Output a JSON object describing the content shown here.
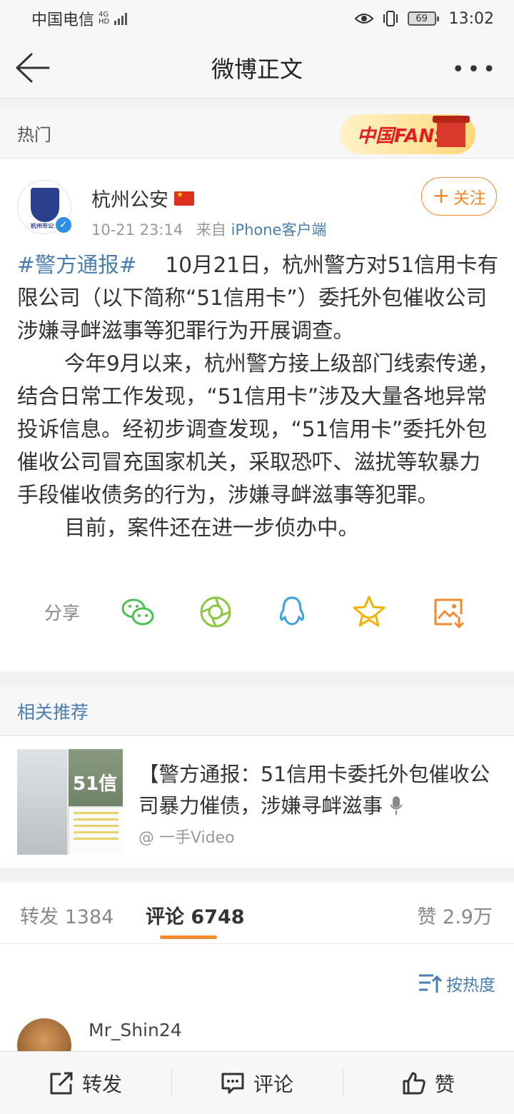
{
  "status": {
    "carrier": "中国电信",
    "network_top": "4G",
    "network_bottom": "HD",
    "battery": "69",
    "time": "13:02"
  },
  "nav": {
    "title": "微博正文"
  },
  "hot": {
    "label": "热门",
    "badge_text": "中国FANS"
  },
  "post": {
    "author": "杭州公安",
    "avatar_caption": "杭州市公安",
    "time": "10-21 23:14",
    "source_prefix": "来自",
    "source": "iPhone客户端",
    "follow_label": "关注",
    "hashtag": "#警方通报#",
    "p1": "10月21日，杭州警方对51信用卡有限公司（以下简称“51信用卡”）委托外包催收公司涉嫌寻衅滋事等犯罪行为开展调查。",
    "p2": "今年9月以来，杭州警方接上级部门线索传递，结合日常工作发现，“51信用卡”涉及大量各地异常投诉信息。经初步调查发现，“51信用卡”委托外包催收公司冒充国家机关，采取恐吓、滋扰等软暴力手段催收债务的行为，涉嫌寻衅滋事等犯罪。",
    "p3": "目前，案件还在进一步侦办中。",
    "share_label": "分享"
  },
  "related": {
    "header": "相关推荐",
    "thumb_text": "51信",
    "title": "【警方通报：51信用卡委托外包催收公司暴力催债，涉嫌寻衅滋事",
    "user": "@ 一手Video"
  },
  "stats": {
    "repost": "转发 1384",
    "comments": "评论 6748",
    "likes": "赞 2.9万"
  },
  "comments": {
    "sort_label": "按热度",
    "first_user": "Mr_Shin24"
  },
  "bottom": {
    "repost": "转发",
    "comment": "评论",
    "like": "赞"
  },
  "colors": {
    "link": "#4a7eb0",
    "accent": "#f08a2c",
    "wechat": "#4cbf54",
    "moments": "#8cc63f",
    "qq": "#3aa0e0",
    "favorite": "#f0b400",
    "save_image": "#f08a2c"
  }
}
